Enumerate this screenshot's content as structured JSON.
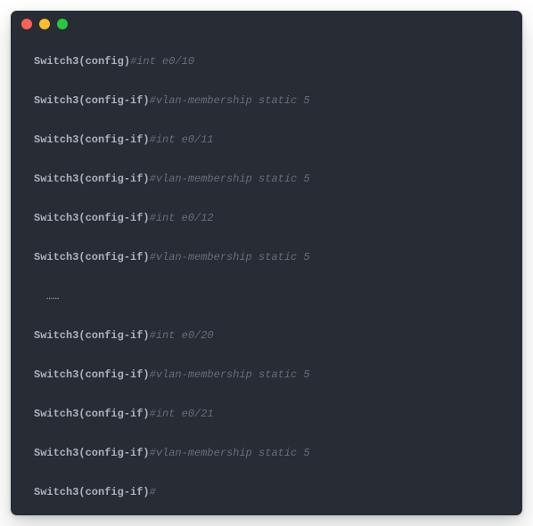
{
  "titlebar": {
    "buttons": [
      "close",
      "minimize",
      "zoom"
    ]
  },
  "terminal": {
    "lines": [
      {
        "prompt": "Switch3(config)",
        "hash": "#",
        "comment": "int e0/10"
      },
      {
        "prompt": "Switch3(config-if)",
        "hash": "#",
        "comment": "vlan-membership static 5"
      },
      {
        "prompt": "Switch3(config-if)",
        "hash": "#",
        "comment": "int e0/11"
      },
      {
        "prompt": "Switch3(config-if)",
        "hash": "#",
        "comment": "vlan-membership static 5"
      },
      {
        "prompt": "Switch3(config-if)",
        "hash": "#",
        "comment": "int e0/12"
      },
      {
        "prompt": "Switch3(config-if)",
        "hash": "#",
        "comment": "vlan-membership static 5"
      },
      {
        "ellipsis": "……"
      },
      {
        "prompt": "Switch3(config-if)",
        "hash": "#",
        "comment": "int e0/20"
      },
      {
        "prompt": "Switch3(config-if)",
        "hash": "#",
        "comment": "vlan-membership static 5"
      },
      {
        "prompt": "Switch3(config-if)",
        "hash": "#",
        "comment": "int e0/21"
      },
      {
        "prompt": "Switch3(config-if)",
        "hash": "#",
        "comment": "vlan-membership static 5"
      },
      {
        "prompt": "Switch3(config-if)",
        "hash": "#",
        "comment": ""
      }
    ]
  }
}
